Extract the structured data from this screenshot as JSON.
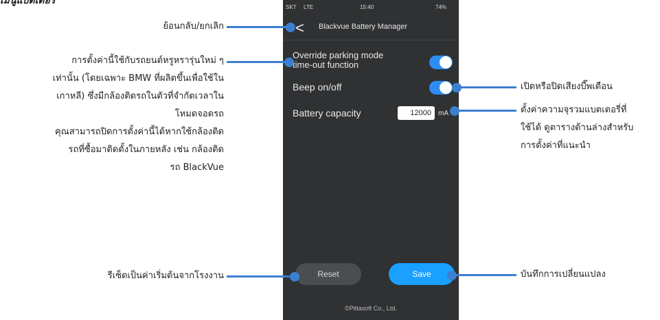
{
  "top_clip": "เมนูแบตเตอรี่",
  "phone": {
    "status": {
      "carrier": "SKT",
      "network": "LTE",
      "time": "15:40",
      "battery": "74%"
    },
    "back_glyph": "<",
    "title": "Blackvue Battery Manager",
    "override_label_line1": "Override parking mode",
    "override_label_line2": "time-out function",
    "override_on": true,
    "beep_label": "Beep on/off",
    "beep_on": true,
    "battery_label": "Battery capacity",
    "battery_value": "12000",
    "battery_unit": "mA",
    "reset_label": "Reset",
    "save_label": "Save",
    "footer": "©Pittasoft Co., Ltd.",
    "colors": {
      "toggle_on": "#2d8cf0",
      "save": "#1aa0ff",
      "background": "#2f3133"
    }
  },
  "callouts": {
    "back": "ย้อนกลับ/ยกเลิก",
    "override_lines": [
      "การตั้งค่านี้ใช้กับรถยนต์หรูหรารุ่นใหม่ ๆ",
      "เท่านั้น (โดยเฉพาะ BMW ที่ผลิตขึ้นเพื่อใช้ใน",
      "เกาหลี) ซึ่งมีกล้องติดรถในตัวที่จำกัดเวลาใน",
      "โหมดจอดรถ",
      "คุณสามารถปิดการตั้งค่านี้ได้หากใช้กล้องติด",
      "รถที่ซื้อมาติดตั้งในภายหลัง เช่น กล้องติด",
      "รถ BlackVue"
    ],
    "reset": "รีเซ็ตเป็นค่าเริ่มต้นจากโรงงาน",
    "beep": "เปิดหรือปิดเสียงบี๊พเตือน",
    "battery_lines": [
      "ตั้งค่าความจุรวมแบตเตอรี่ที่",
      "ใช้ได้ ดูตารางด้านล่างสำหรับ",
      "การตั้งค่าที่แนะนำ"
    ],
    "save": "บันทึกการเปลี่ยนแปลง"
  }
}
